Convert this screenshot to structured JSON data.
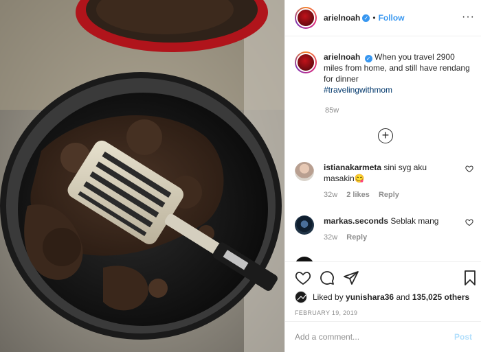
{
  "post": {
    "username": "arielnoah",
    "follow_label": "Follow",
    "more_icon": "more-options-icon",
    "caption": "When you travel 2900 miles from home, and still have rendang for dinner",
    "hashtag": "#travelingwithmom",
    "age": "85w"
  },
  "comments": [
    {
      "username": "istianakarmeta",
      "text": "sini syg aku masakin",
      "emoji": "😋",
      "age": "32w",
      "likes": "2 likes",
      "reply": "Reply"
    },
    {
      "username": "markas.seconds",
      "text": "Seblak mang",
      "age": "32w",
      "reply": "Reply"
    }
  ],
  "engagement": {
    "liked_prefix": "Liked by",
    "liked_user": "yunishara36",
    "and": "and",
    "others": "135,025 others",
    "date": "FEBRUARY 19, 2019"
  },
  "composer": {
    "placeholder": "Add a comment...",
    "post_label": "Post"
  },
  "colors": {
    "accent": "#3897f0",
    "text": "#262626",
    "muted": "#8e8e8e",
    "hashtag": "#00376b"
  }
}
